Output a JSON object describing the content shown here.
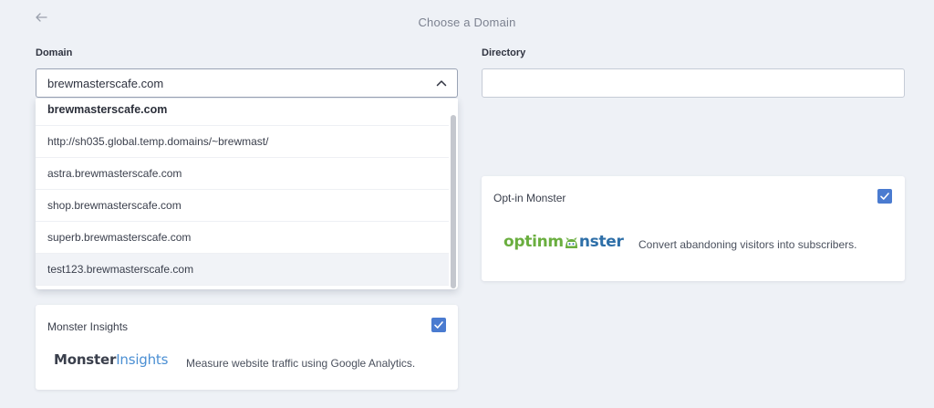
{
  "header": {
    "title": "Choose a Domain"
  },
  "form": {
    "domain_label": "Domain",
    "directory_label": "Directory",
    "domain_value": "brewmasterscafe.com",
    "directory_value": "",
    "directory_placeholder": ""
  },
  "dropdown": {
    "options": [
      "brewmasterscafe.com",
      "http://sh035.global.temp.domains/~brewmast/",
      "astra.brewmasterscafe.com",
      "shop.brewmasterscafe.com",
      "superb.brewmasterscafe.com",
      "test123.brewmasterscafe.com"
    ],
    "selected_index": 0,
    "hovered_index": 5
  },
  "plugins": {
    "optin": {
      "title": "Opt-in Monster",
      "logo_text_left": "optinm",
      "logo_text_right": "nster",
      "description": "Convert abandoning visitors into subscribers.",
      "checked": true
    },
    "insights": {
      "title": "Monster Insights",
      "logo_text_bold": "Monster",
      "logo_text_light": "Insights",
      "description": "Measure website traffic using Google Analytics.",
      "checked": true
    }
  },
  "colors": {
    "background": "#eef1f6",
    "checkbox_blue": "#4a7bd0",
    "optin_green": "#6aae3f",
    "optin_blue": "#2e6fa8",
    "insights_blue": "#4b8fd3"
  },
  "icons": {
    "back": "arrow-left-icon",
    "select": "chevron-up-icon",
    "check": "checkmark-icon"
  }
}
